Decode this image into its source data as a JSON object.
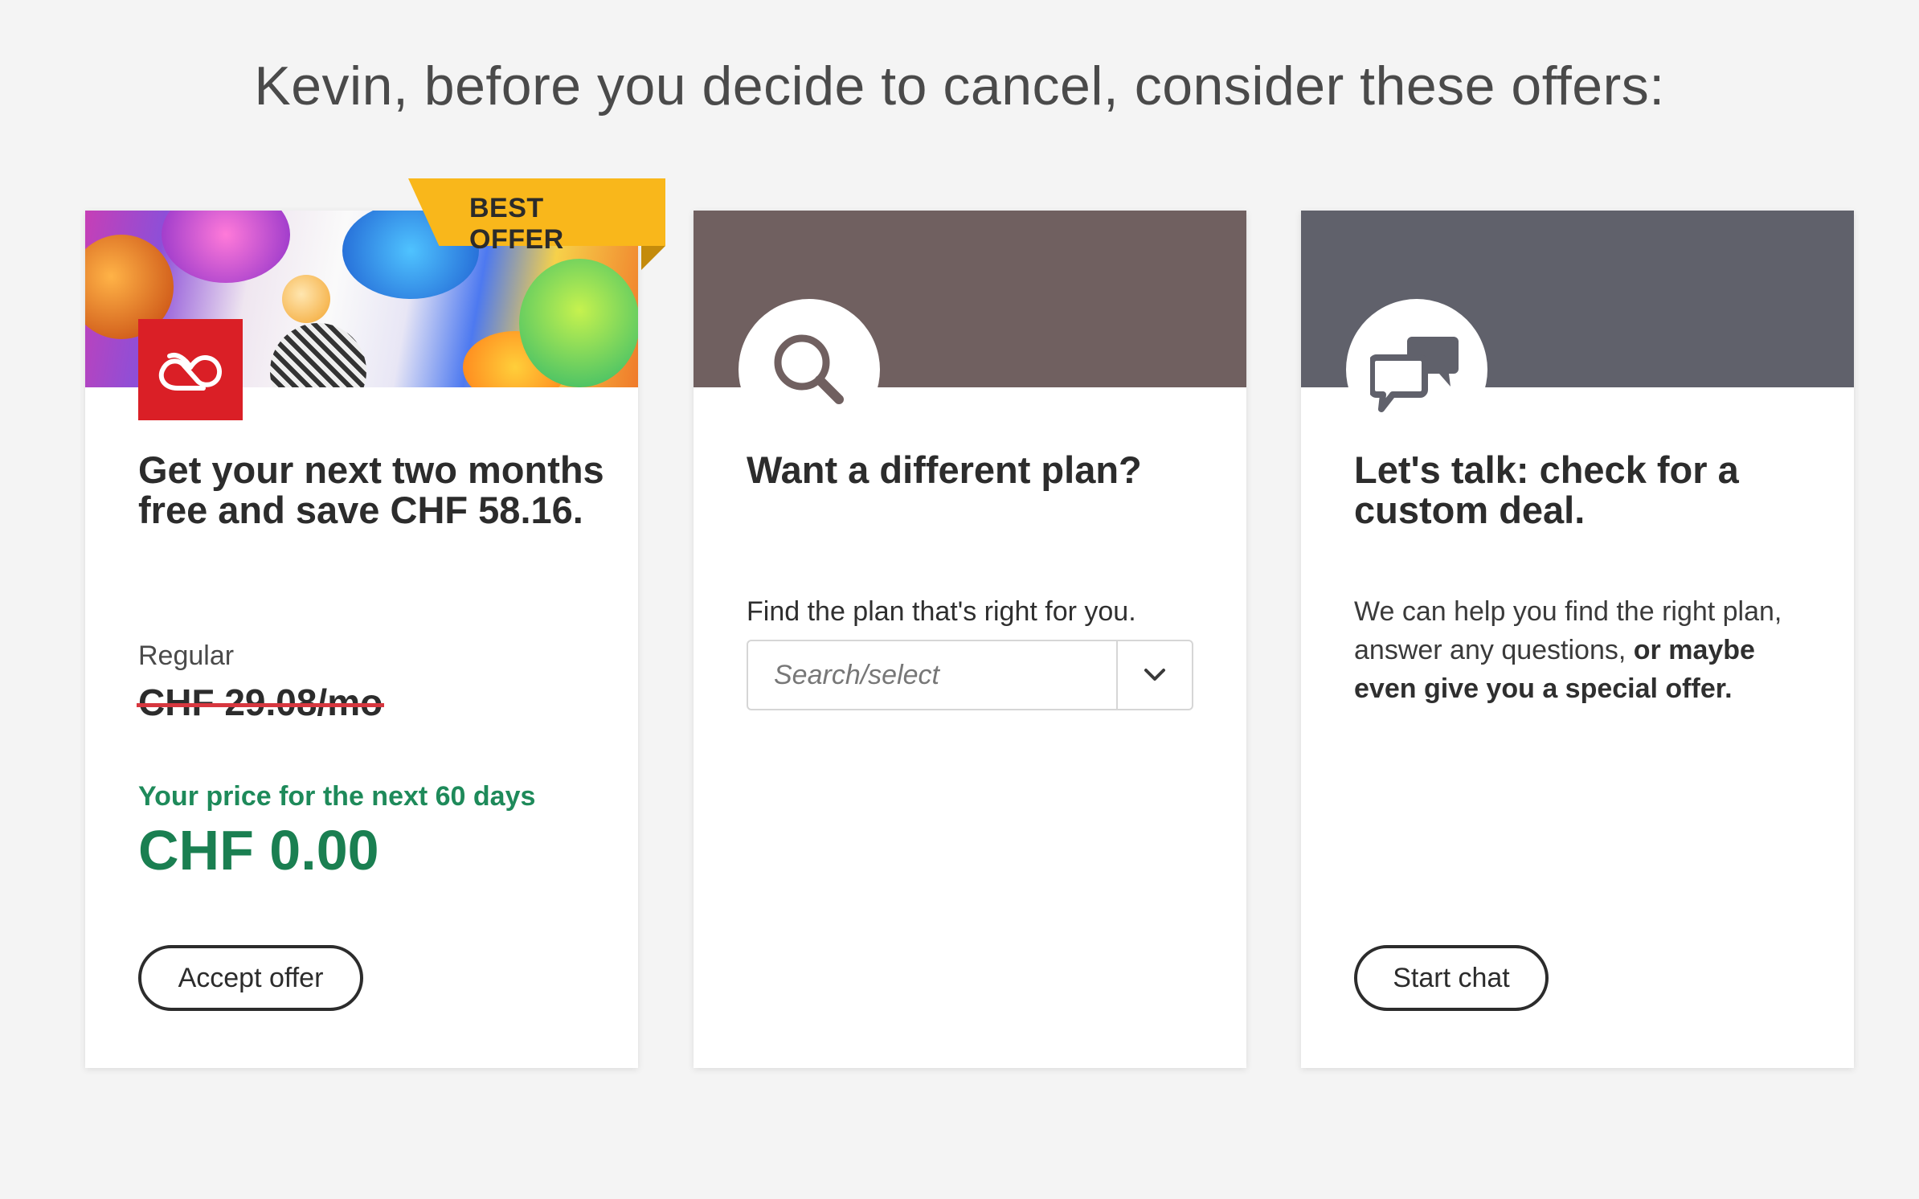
{
  "headline": "Kevin, before you decide to cancel, consider these offers:",
  "offers": [
    {
      "badge": "BEST OFFER",
      "title": "Get your next two months free and save CHF 58.16.",
      "regular_label": "Regular",
      "regular_price": "CHF 29.08/mo",
      "promo_label": "Your price for the next 60 days",
      "promo_price": "CHF 0.00",
      "button": "Accept offer",
      "icon": "creative-cloud-icon",
      "accent": "#da1f26"
    },
    {
      "title": "Want a different plan?",
      "find_label": "Find the plan that's right for you.",
      "select_placeholder": "Search/select",
      "select_value": "",
      "icon": "search-icon",
      "header_color": "#706060"
    },
    {
      "title": "Let's talk: check for a custom deal.",
      "body_plain": "We can help you find the right plan, answer any questions, ",
      "body_bold": "or maybe even give you a special offer.",
      "button": "Start chat",
      "icon": "chat-icon",
      "header_color": "#60616b"
    }
  ],
  "colors": {
    "price_green": "#1a7f51",
    "strike_red": "#d7373f",
    "badge_yellow": "#f9b71b",
    "background": "#f4f4f4"
  }
}
